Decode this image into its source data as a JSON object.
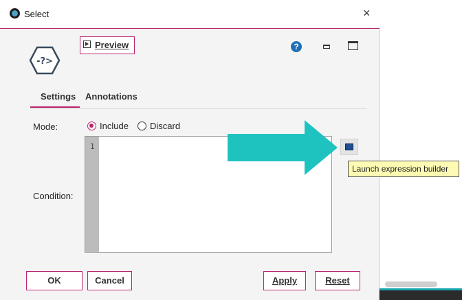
{
  "window": {
    "title": "Select",
    "close_symbol": "×"
  },
  "toolbar": {
    "preview_label": "Preview",
    "help_symbol": "?"
  },
  "tabs": [
    {
      "label": "Settings",
      "active": true
    },
    {
      "label": "Annotations",
      "active": false
    }
  ],
  "mode": {
    "label": "Mode:",
    "options": [
      "Include",
      "Discard"
    ],
    "selected": "Include"
  },
  "condition": {
    "label": "Condition:",
    "line_number": "1",
    "value": ""
  },
  "expression_builder": {
    "icon": "expression-builder-icon",
    "tooltip": "Launch expression builder"
  },
  "buttons": {
    "ok": "OK",
    "cancel": "Cancel",
    "apply": "Apply",
    "reset": "Reset"
  },
  "colors": {
    "accent": "#b8246d",
    "arrow": "#1ec3c0",
    "tooltip_bg": "#fdfab3",
    "help": "#1f6fb5"
  }
}
